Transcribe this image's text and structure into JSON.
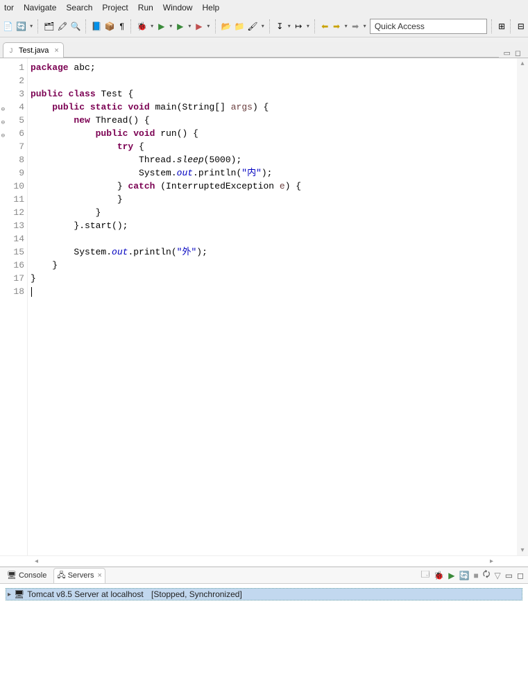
{
  "menu": {
    "items": [
      "tor",
      "Navigate",
      "Search",
      "Project",
      "Run",
      "Window",
      "Help"
    ]
  },
  "quick_access": "Quick Access",
  "editor_tab": {
    "label": "Test.java",
    "close": "×"
  },
  "code_lines": [
    {
      "n": 1,
      "html": "<span class='kw'>package</span> abc;"
    },
    {
      "n": 2,
      "html": ""
    },
    {
      "n": 3,
      "html": "<span class='kw'>public</span> <span class='kw'>class</span> <span class='cls'>Test</span> {"
    },
    {
      "n": 4,
      "gm": "⊖",
      "html": "    <span class='kw'>public</span> <span class='kw'>static</span> <span class='kw'>void</span> <span class='method'>main</span>(String[] <span class='var'>args</span>) {"
    },
    {
      "n": 5,
      "gm": "⊖",
      "html": "        <span class='kw'>new</span> Thread() {"
    },
    {
      "n": 6,
      "gm": "⊖",
      "am": "▲",
      "html": "            <span class='kw'>public</span> <span class='kw'>void</span> <span class='method'>run</span>() {"
    },
    {
      "n": 7,
      "html": "                <span class='kw'>try</span> {"
    },
    {
      "n": 8,
      "html": "                    Thread.<span class='itf'>sleep</span>(5000);"
    },
    {
      "n": 9,
      "html": "                    System.<span class='field'>out</span>.println(<span class='str'>\"内\"</span>);"
    },
    {
      "n": 10,
      "html": "                } <span class='kw'>catch</span> (InterruptedException <span class='var'>e</span>) {"
    },
    {
      "n": 11,
      "html": "                }"
    },
    {
      "n": 12,
      "html": "            }"
    },
    {
      "n": 13,
      "html": "        }.start();"
    },
    {
      "n": 14,
      "html": ""
    },
    {
      "n": 15,
      "html": "        System.<span class='field'>out</span>.println(<span class='str'>\"外\"</span>);"
    },
    {
      "n": 16,
      "html": "    }"
    },
    {
      "n": 17,
      "html": "}"
    },
    {
      "n": 18,
      "html": "<span class='caret'></span>"
    }
  ],
  "bottom_tabs": {
    "console": "Console",
    "servers": "Servers"
  },
  "server_row": {
    "label": "Tomcat v8.5 Server at localhost",
    "state": "[Stopped, Synchronized]"
  }
}
